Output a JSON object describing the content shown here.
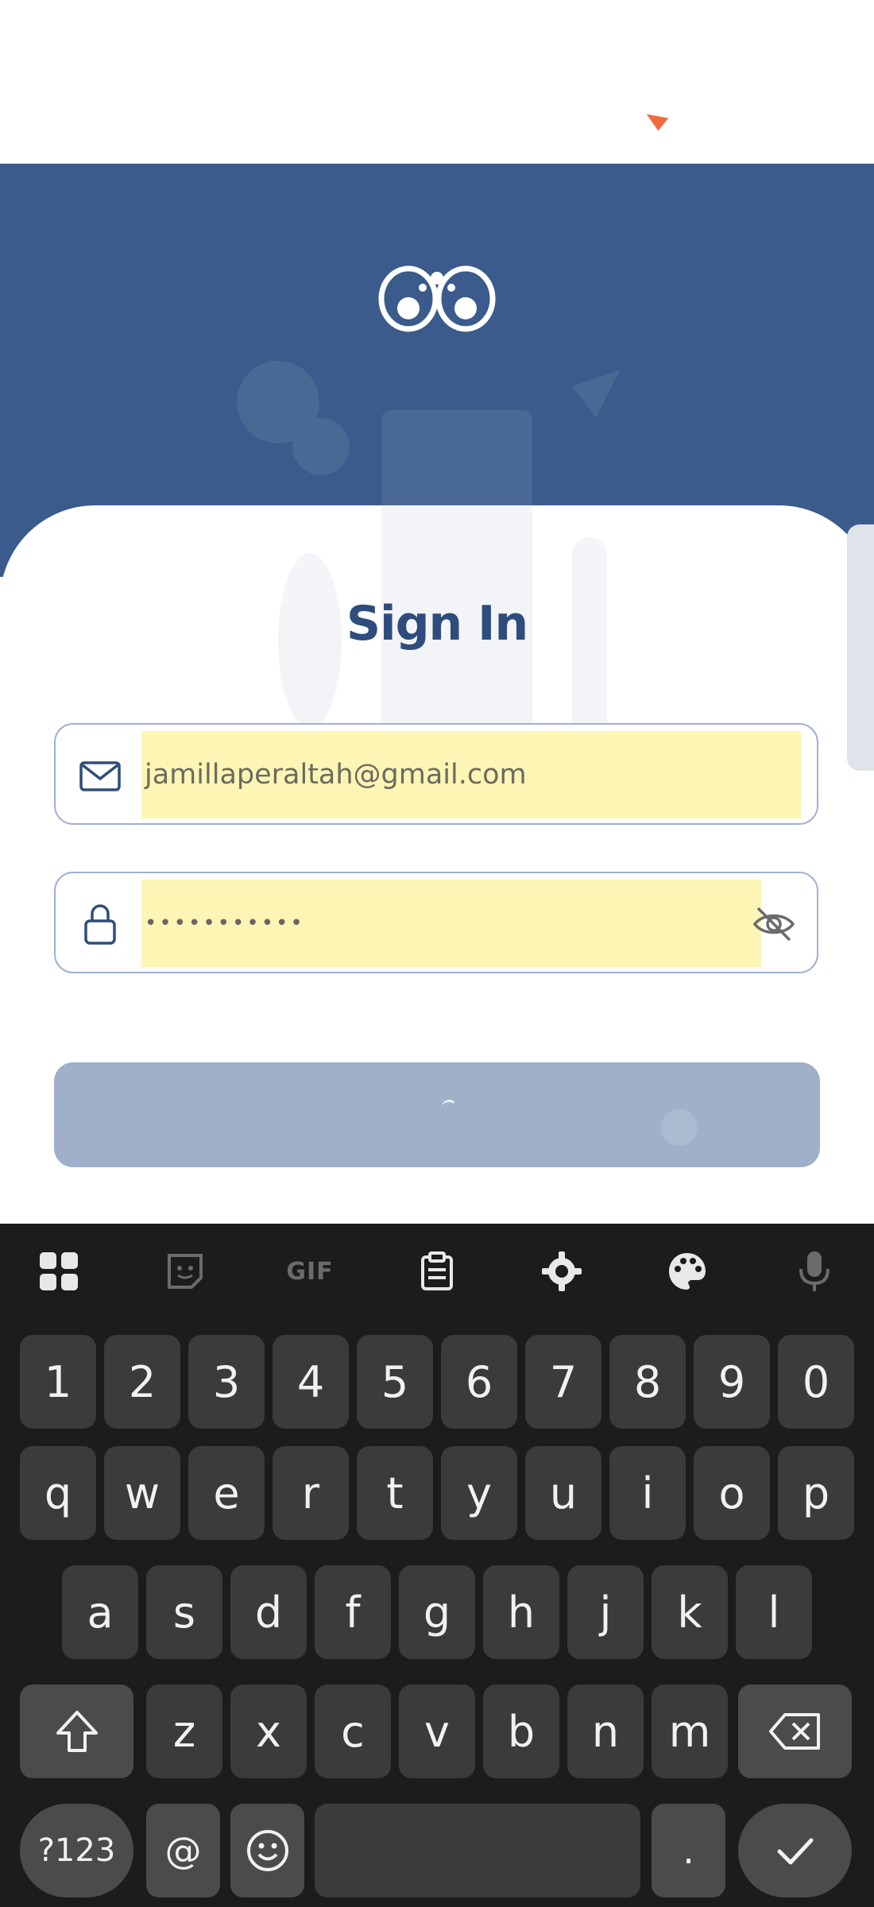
{
  "signin": {
    "title": "Sign In",
    "email_value": "jamillaperaltah@gmail.com",
    "password_masked": "•••••••••••"
  },
  "colors": {
    "header_bg": "#3a5b8b",
    "title": "#2f4d7c",
    "autofill": "#fdf5b4",
    "button": "#9fb0c8",
    "keyboard_bg": "#1c1c1c",
    "key_bg": "#3b3b3b",
    "accent_mark": "#f26a3a"
  },
  "keyboard": {
    "toolbar": {
      "gif_label": "GIF",
      "icons": [
        "apps-grid-icon",
        "sticker-icon",
        "gif-icon",
        "clipboard-icon",
        "gear-icon",
        "palette-icon",
        "microphone-icon"
      ]
    },
    "row_numbers": [
      "1",
      "2",
      "3",
      "4",
      "5",
      "6",
      "7",
      "8",
      "9",
      "0"
    ],
    "row_q": [
      "q",
      "w",
      "e",
      "r",
      "t",
      "y",
      "u",
      "i",
      "o",
      "p"
    ],
    "row_a": [
      "a",
      "s",
      "d",
      "f",
      "g",
      "h",
      "j",
      "k",
      "l"
    ],
    "row_z": [
      "z",
      "x",
      "c",
      "v",
      "b",
      "n",
      "m"
    ],
    "symbols_label": "?123",
    "at_label": "@",
    "period_label": ".",
    "icons": [
      "shift-icon",
      "backspace-icon",
      "emoji-icon",
      "check-icon"
    ]
  }
}
